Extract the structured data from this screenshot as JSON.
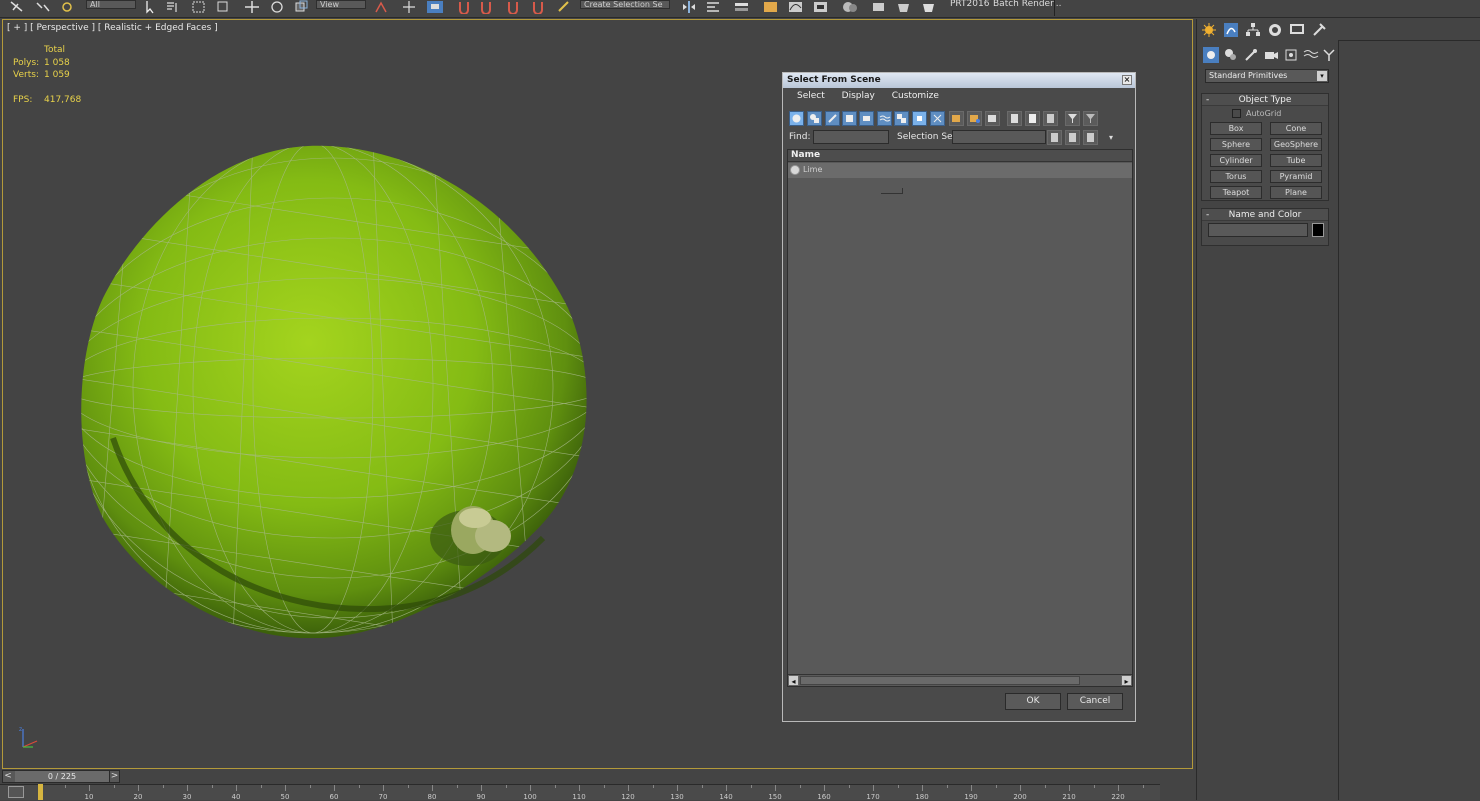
{
  "toolbar": {
    "selection_filter": "All",
    "ref_coord": "View",
    "named_selection": "Create Selection Se",
    "prt_label": "PRT2016",
    "batch_render": "Batch Render..."
  },
  "viewport": {
    "label": "[ + ] [ Perspective ] [ Realistic + Edged Faces ]",
    "stats": {
      "total_label": "Total",
      "polys_label": "Polys:",
      "polys_value": "1 058",
      "verts_label": "Verts:",
      "verts_value": "1 059",
      "fps_label": "FPS:",
      "fps_value": "417,768"
    },
    "object_colors": {
      "lime_light": "#8fc71a",
      "lime_dark": "#3d6b0e",
      "wire": "#9bb46f"
    }
  },
  "dialog": {
    "title": "Select From Scene",
    "close": "×",
    "menu": [
      "Select",
      "Display",
      "Customize"
    ],
    "find_label": "Find:",
    "find_value": "",
    "selection_set_label": "Selection Set:",
    "selection_set_value": "",
    "column_name": "Name",
    "rows": [
      {
        "name": "Lime",
        "icon": "sphere-icon"
      }
    ],
    "ok": "OK",
    "cancel": "Cancel"
  },
  "command_panel": {
    "category": "Standard Primitives",
    "object_type_title": "Object Type",
    "autogrid": "AutoGrid",
    "primitives": [
      "Box",
      "Cone",
      "Sphere",
      "GeoSphere",
      "Cylinder",
      "Tube",
      "Torus",
      "Pyramid",
      "Teapot",
      "Plane"
    ],
    "name_color_title": "Name and Color",
    "name_value": "",
    "swatch_color": "#000000"
  },
  "timeline": {
    "slider_text": "0 / 225",
    "prev": "<",
    "next": ">",
    "ticks": [
      "10",
      "20",
      "30",
      "40",
      "50",
      "60",
      "70",
      "80",
      "90",
      "100",
      "110",
      "120",
      "130",
      "140",
      "150",
      "160",
      "170",
      "180",
      "190",
      "200",
      "210",
      "220"
    ]
  }
}
